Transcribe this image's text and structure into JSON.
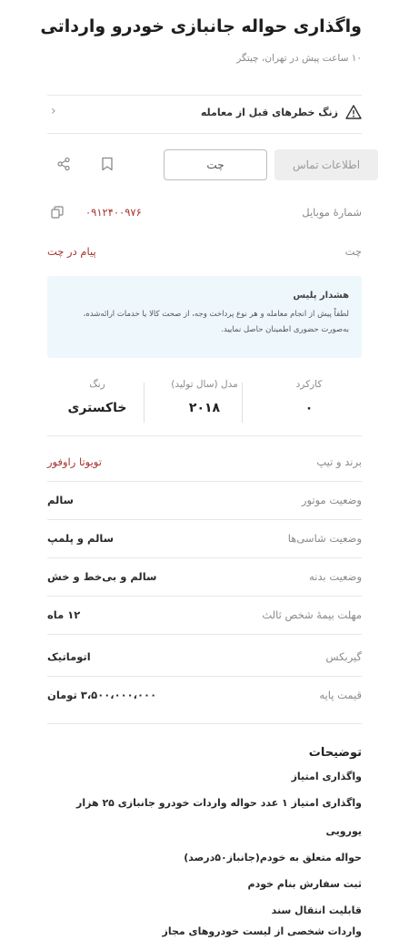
{
  "header": {
    "title": "واگذاری حواله جانبازی خودرو وارداتی",
    "subtitle": "۱۰ ساعت پیش در تهران، چیتگر"
  },
  "warning": {
    "text": "زنگ خطرهای قبل از معامله",
    "icon": "warning-triangle-icon"
  },
  "actions": {
    "contact_label": "اطلاعات تماس",
    "chat_label": "چت"
  },
  "contact": {
    "mobile_label": "شمارهٔ موبایل",
    "mobile_value": "۰۹۱۲۴۰۰۹۷۶",
    "chat_label": "چت",
    "chat_value": "پیام در چت"
  },
  "notice": {
    "title": "هشدار پلیس",
    "body": "لطفاً پیش از انجام معامله و هر نوع پرداخت وجه، از صحت کالا یا خدمات ارائه‌شده، به‌صورت حضوری اطمینان حاصل نمایید."
  },
  "stats": [
    {
      "label": "کارکرد",
      "value": "۰"
    },
    {
      "label": "مدل (سال تولید)",
      "value": "۲۰۱۸"
    },
    {
      "label": "رنگ",
      "value": "خاکستری"
    }
  ],
  "specs": [
    {
      "label": "برند و تیپ",
      "value": "تویوتا راوفور",
      "red": true
    },
    {
      "label": "وضعیت موتور",
      "value": "سالم"
    },
    {
      "label": "وضعیت شاسی‌ها",
      "value": "سالم و پلمپ"
    },
    {
      "label": "وضعیت بدنه",
      "value": "سالم و بی‌خط و خش"
    },
    {
      "label": "مهلت بیمهٔ شخص ثالث",
      "value": "۱۲ ماه"
    },
    {
      "label": "گیربکس",
      "value": "اتوماتیک"
    },
    {
      "label": "قیمت پایه",
      "value": "۳،۵۰۰،۰۰۰،۰۰۰ تومان"
    }
  ],
  "description": {
    "title": "توضیحات",
    "lines": [
      "واگذاری امتیاز",
      "واگذاری امتیاز ۱ عدد حواله واردات خودرو جانبازی ۲۵ هزار",
      "یورویی",
      "حواله متعلق به خودم(جانباز۵۰درصد)",
      "ثبت سفارش بنام خودم",
      "قابلیت انتقال سند",
      "واردات شخصی از لیست خودروهای مجاز"
    ]
  }
}
